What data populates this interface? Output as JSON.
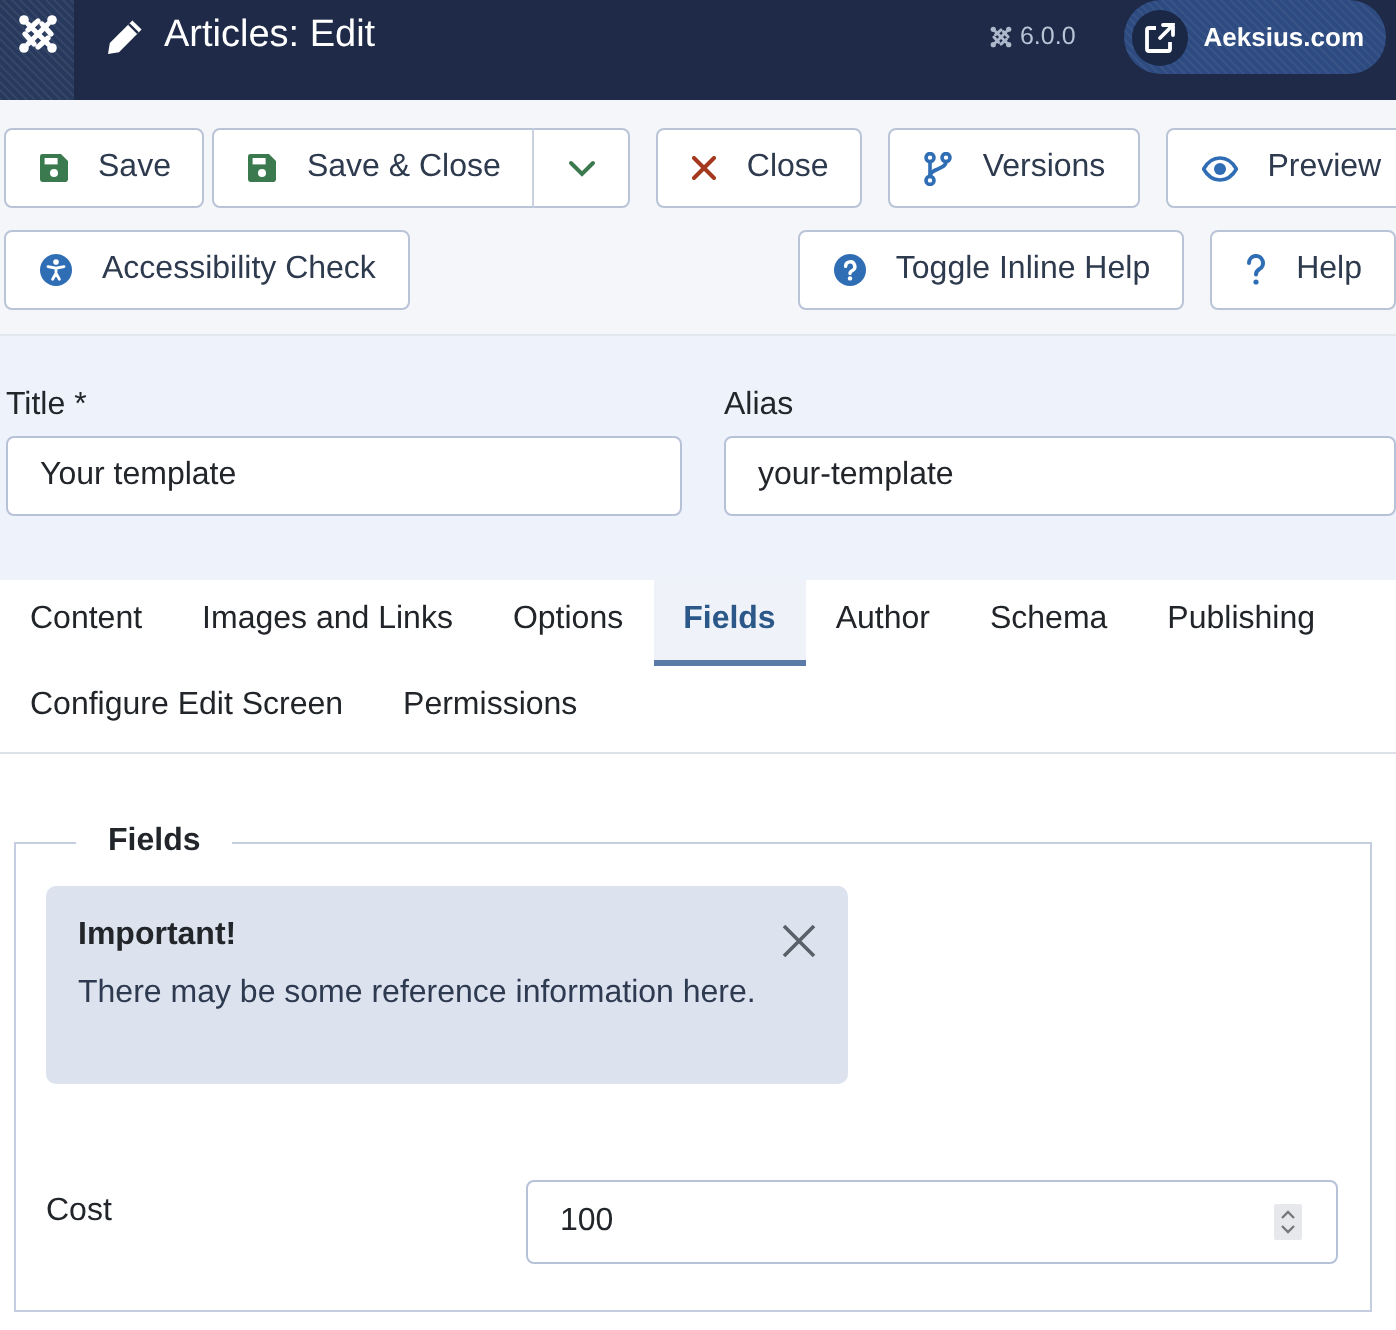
{
  "header": {
    "title": "Articles: Edit",
    "version": "6.0.0",
    "site_link": "Aeksius.com"
  },
  "toolbar": {
    "rows": [
      {
        "start": [
          {
            "label": "Save",
            "kind": "save",
            "dropdown": false
          },
          {
            "label": "Save & Close",
            "kind": "save",
            "dropdown": true
          },
          {
            "label": "Close",
            "kind": "close",
            "dropdown": false
          },
          {
            "label": "Versions",
            "kind": "versions",
            "dropdown": false
          },
          {
            "label": "Preview",
            "kind": "preview",
            "dropdown": false
          }
        ]
      },
      {
        "start": [
          {
            "label": "Accessibility Check",
            "kind": "accessibility",
            "dropdown": false
          }
        ],
        "end": [
          {
            "label": "Toggle Inline Help",
            "kind": "inline-help",
            "dropdown": false
          },
          {
            "label": "Help",
            "kind": "help",
            "dropdown": false
          }
        ]
      }
    ]
  },
  "form": {
    "fields": [
      {
        "label": "Title *",
        "value": "Your template"
      },
      {
        "label": "Alias",
        "value": "your-template"
      }
    ]
  },
  "tabs": [
    {
      "label": "Content",
      "selected": false
    },
    {
      "label": "Images and Links",
      "selected": false
    },
    {
      "label": "Options",
      "selected": false
    },
    {
      "label": "Fields",
      "selected": true
    },
    {
      "label": "Author",
      "selected": false
    },
    {
      "label": "Schema",
      "selected": false
    },
    {
      "label": "Publishing",
      "selected": false
    },
    {
      "label": "Configure Edit Screen",
      "selected": false
    },
    {
      "label": "Permissions",
      "selected": false
    }
  ],
  "fieldset": {
    "legend": "Fields",
    "alert": {
      "heading": "Important!",
      "text": "There may be some reference information here."
    },
    "fields": [
      {
        "label": "Cost",
        "value": "100"
      }
    ]
  }
}
